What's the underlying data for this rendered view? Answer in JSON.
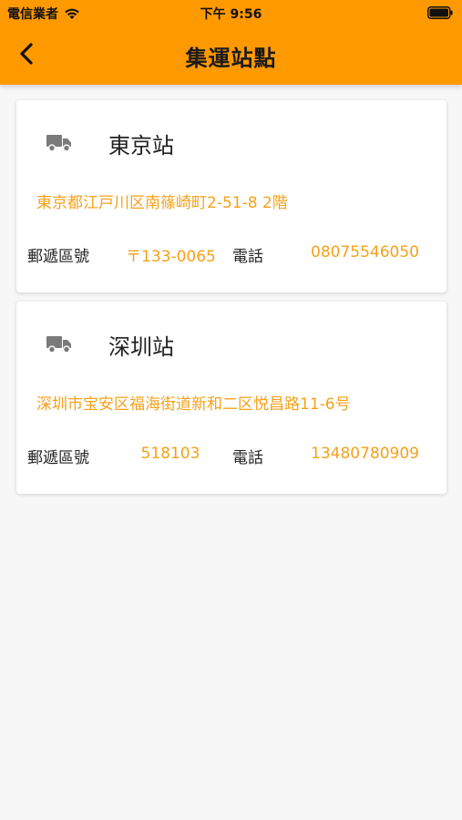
{
  "status_bar": {
    "carrier": "電信業者",
    "time": "下午 9:56"
  },
  "header": {
    "title": "集運站點",
    "back_icon": "chevron-left-icon"
  },
  "colors": {
    "accent": "#ff9900",
    "value_text": "#f5a11a",
    "icon_gray": "#7a7a7a"
  },
  "stations": [
    {
      "icon": "truck-icon",
      "name": "東京站",
      "address": "東京都江戸川区南篠崎町2-51-8 2階",
      "postal_label": "郵遞區號",
      "postal_code": "〒133-0065",
      "phone_label": "電話",
      "phone": "08075546050"
    },
    {
      "icon": "truck-icon",
      "name": "深圳站",
      "address": "深圳市宝安区福海街道新和二区悦昌路11-6号",
      "postal_label": "郵遞區號",
      "postal_code": "518103",
      "phone_label": "電話",
      "phone": "13480780909"
    }
  ]
}
